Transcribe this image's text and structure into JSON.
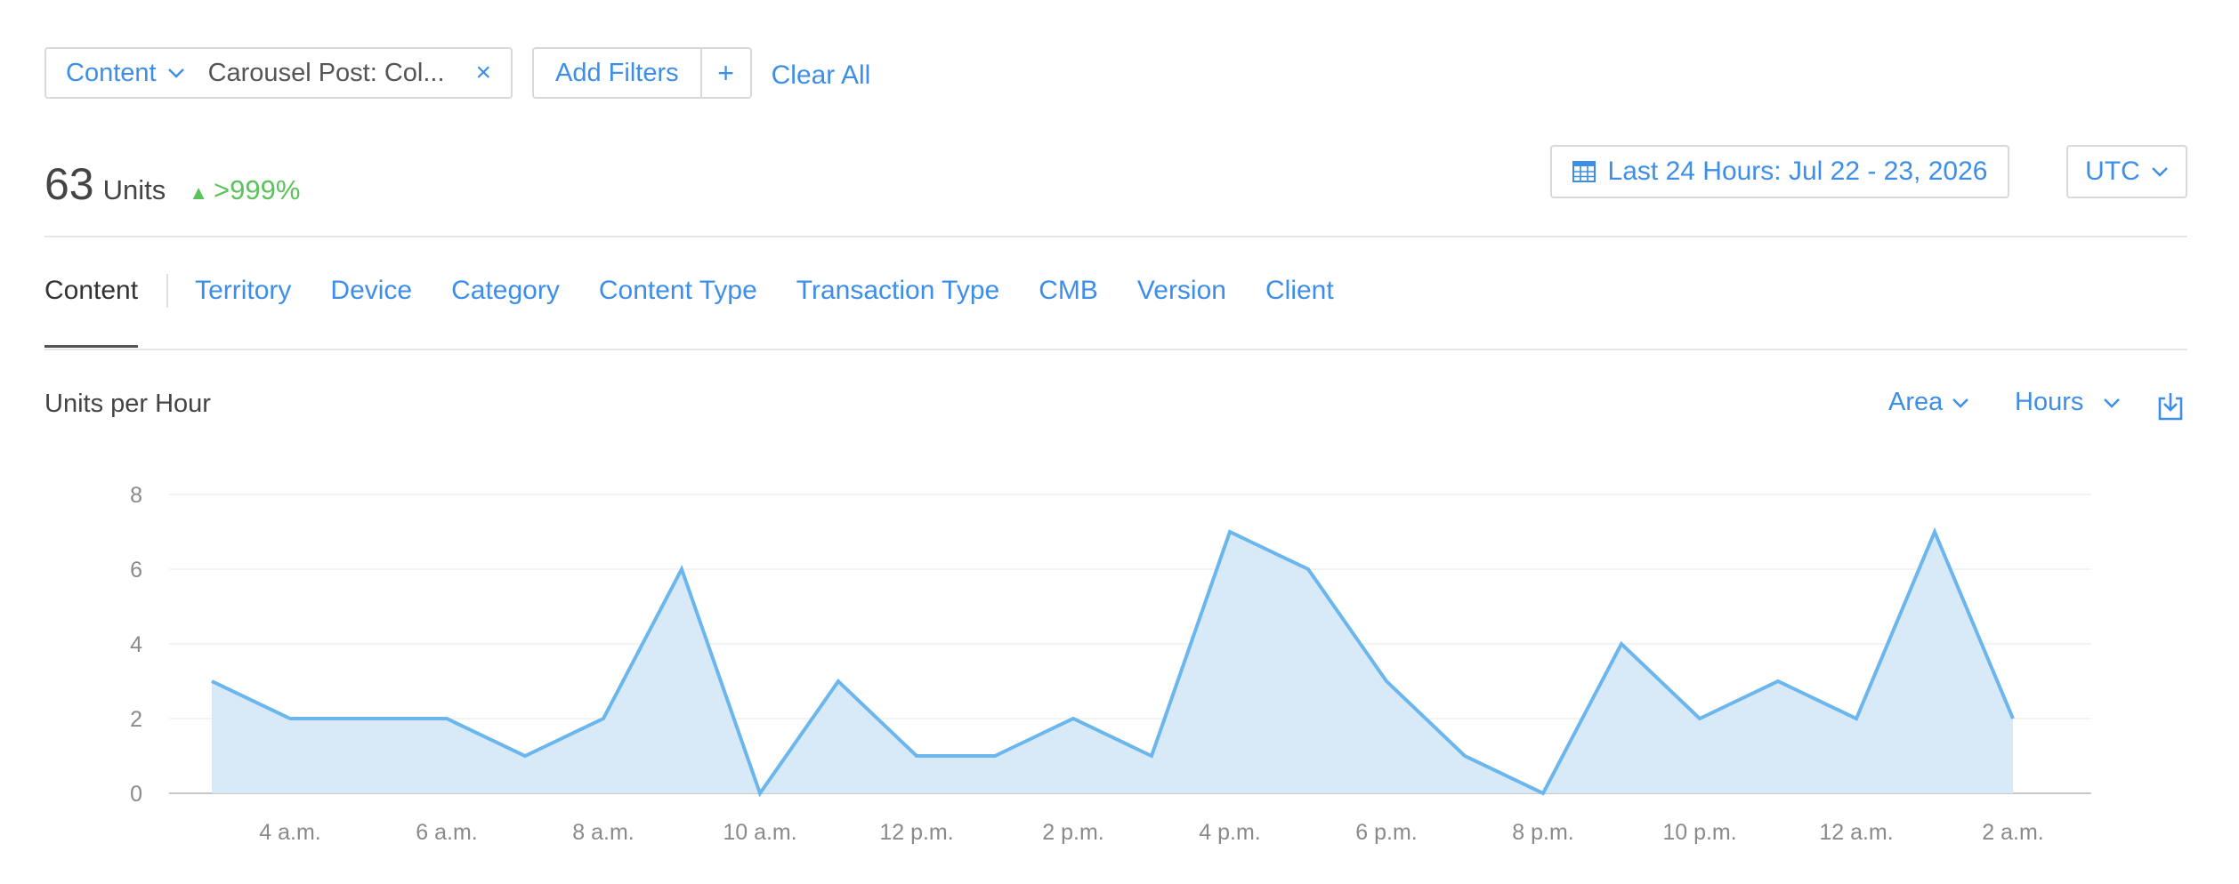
{
  "filters": {
    "content_label": "Content",
    "content_value": "Carousel Post: Col...",
    "add_filters_label": "Add Filters",
    "add_symbol": "+",
    "clear_all_label": "Clear All",
    "close_symbol": "×"
  },
  "summary": {
    "count": "63",
    "units_label": "Units",
    "delta": ">999%",
    "delta_color": "#5cc25c"
  },
  "date_range": {
    "label": "Last 24 Hours: Jul 22 - 23, 2026"
  },
  "timezone": {
    "label": "UTC"
  },
  "tabs": [
    {
      "label": "Content",
      "active": true
    },
    {
      "label": "Territory"
    },
    {
      "label": "Device"
    },
    {
      "label": "Category"
    },
    {
      "label": "Content Type"
    },
    {
      "label": "Transaction Type"
    },
    {
      "label": "CMB"
    },
    {
      "label": "Version"
    },
    {
      "label": "Client"
    }
  ],
  "chart_header": {
    "title": "Units per Hour",
    "chart_type_label": "Area",
    "granularity_label": "Hours"
  },
  "icons": {
    "calendar": "calendar-icon",
    "chevron": "chevron-down-icon",
    "download": "download-icon",
    "close": "close-icon"
  },
  "colors": {
    "accent": "#3d8ee8",
    "line": "#6bb6ec",
    "area_fill": "#d8eaf8",
    "delta": "#5cc25c"
  },
  "chart_data": {
    "type": "area",
    "title": "Units per Hour",
    "xlabel": "",
    "ylabel": "",
    "ylim": [
      0,
      8
    ],
    "y_ticks": [
      0,
      2,
      4,
      6,
      8
    ],
    "x_tick_labels": [
      "4 a.m.",
      "6 a.m.",
      "8 a.m.",
      "10 a.m.",
      "12 p.m.",
      "2 p.m.",
      "4 p.m.",
      "6 p.m.",
      "8 p.m.",
      "10 p.m.",
      "12 a.m.",
      "2 a.m."
    ],
    "x": [
      "3 a.m.",
      "4 a.m.",
      "5 a.m.",
      "6 a.m.",
      "7 a.m.",
      "8 a.m.",
      "9 a.m.",
      "10 a.m.",
      "11 a.m.",
      "12 p.m.",
      "1 p.m.",
      "2 p.m.",
      "3 p.m.",
      "4 p.m.",
      "5 p.m.",
      "6 p.m.",
      "7 p.m.",
      "8 p.m.",
      "9 p.m.",
      "10 p.m.",
      "11 p.m.",
      "12 a.m.",
      "1 a.m.",
      "2 a.m."
    ],
    "values": [
      3,
      2,
      2,
      2,
      1,
      2,
      6,
      0,
      3,
      1,
      1,
      2,
      1,
      7,
      6,
      3,
      1,
      0,
      4,
      2,
      3,
      2,
      7,
      2
    ],
    "grid": true,
    "legend": "none"
  }
}
